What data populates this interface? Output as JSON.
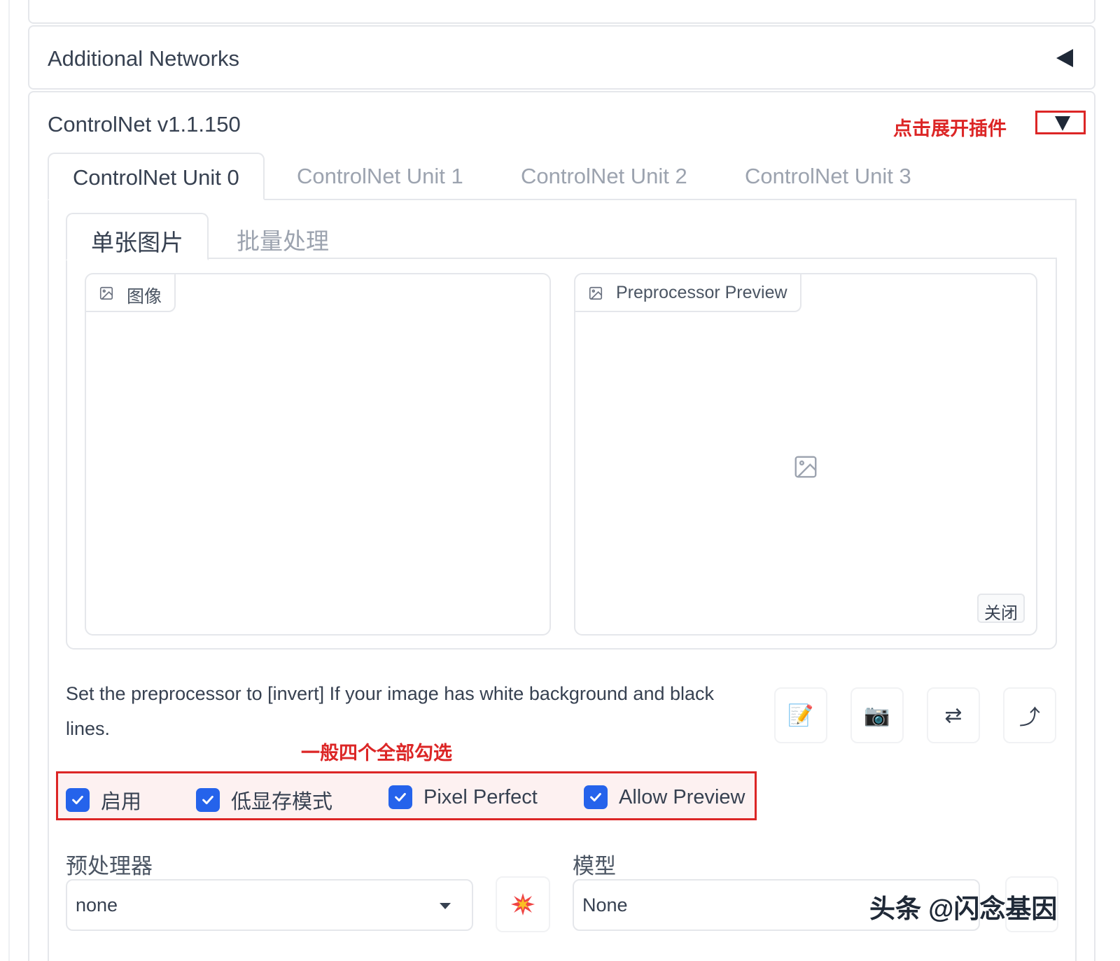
{
  "accordions": {
    "additional_networks": {
      "title": "Additional Networks"
    },
    "controlnet": {
      "title": "ControlNet v1.1.150"
    }
  },
  "annotations": {
    "expand_plugin": "点击展开插件",
    "check_all_four": "一般四个全部勾选"
  },
  "unit_tabs": [
    {
      "label": "ControlNet Unit 0",
      "active": true
    },
    {
      "label": "ControlNet Unit 1",
      "active": false
    },
    {
      "label": "ControlNet Unit 2",
      "active": false
    },
    {
      "label": "ControlNet Unit 3",
      "active": false
    }
  ],
  "mode_tabs": [
    {
      "label": "单张图片",
      "active": true
    },
    {
      "label": "批量处理",
      "active": false
    }
  ],
  "image_input": {
    "label": "图像"
  },
  "preview": {
    "label": "Preprocessor Preview",
    "close_label": "关闭"
  },
  "hint": "Set the preprocessor to [invert] If your image has white background and black lines.",
  "tool_buttons": [
    {
      "icon": "edit-icon",
      "glyph": "📝"
    },
    {
      "icon": "camera-icon",
      "glyph": "📷"
    },
    {
      "icon": "swap-icon",
      "glyph": "⇄"
    },
    {
      "icon": "send-dimensions-icon",
      "glyph": "⤴"
    }
  ],
  "checkboxes": [
    {
      "label": "启用",
      "checked": true
    },
    {
      "label": "低显存模式",
      "checked": true
    },
    {
      "label": "Pixel Perfect",
      "checked": true
    },
    {
      "label": "Allow Preview",
      "checked": true
    }
  ],
  "preprocessor": {
    "label": "预处理器",
    "value": "none"
  },
  "model": {
    "label": "模型",
    "value": "None"
  },
  "watermark": "头条 @闪念基因",
  "colors": {
    "accent": "#2563eb",
    "annotation_red": "#dc2626",
    "border": "#e5e7eb"
  }
}
